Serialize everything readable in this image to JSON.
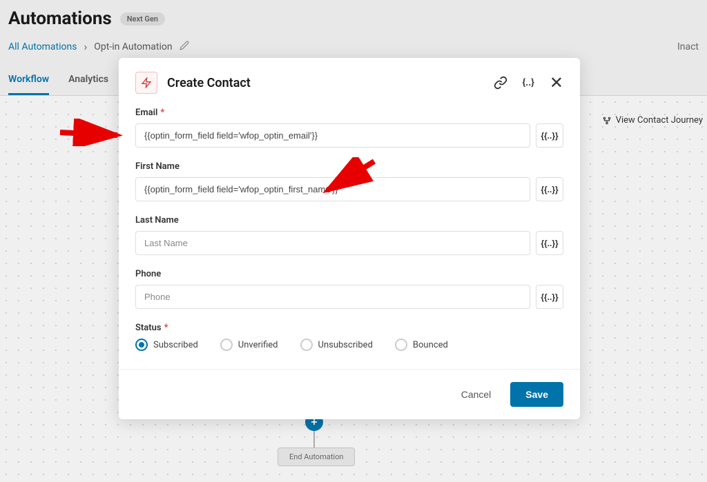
{
  "header": {
    "title": "Automations",
    "badge": "Next Gen",
    "breadcrumb_root": "All Automations",
    "breadcrumb_current": "Opt-in Automation",
    "status": "Inact"
  },
  "tabs": {
    "workflow": "Workflow",
    "analytics": "Analytics"
  },
  "canvas": {
    "journey_button": "View Contact Journey",
    "end_node": "End Automation"
  },
  "modal": {
    "title": "Create Contact",
    "fields": {
      "email": {
        "label": "Email",
        "value": "{{optin_form_field field='wfop_optin_email'}}",
        "required": true
      },
      "first_name": {
        "label": "First Name",
        "value": "{{optin_form_field field='wfop_optin_first_name'}}",
        "required": false
      },
      "last_name": {
        "label": "Last Name",
        "value": "",
        "placeholder": "Last Name",
        "required": false
      },
      "phone": {
        "label": "Phone",
        "value": "",
        "placeholder": "Phone",
        "required": false
      },
      "status": {
        "label": "Status",
        "required": true,
        "options": [
          "Subscribed",
          "Unverified",
          "Unsubscribed",
          "Bounced"
        ],
        "selected": "Subscribed"
      }
    },
    "merge_tag_label": "{{..}}",
    "buttons": {
      "cancel": "Cancel",
      "save": "Save"
    }
  }
}
